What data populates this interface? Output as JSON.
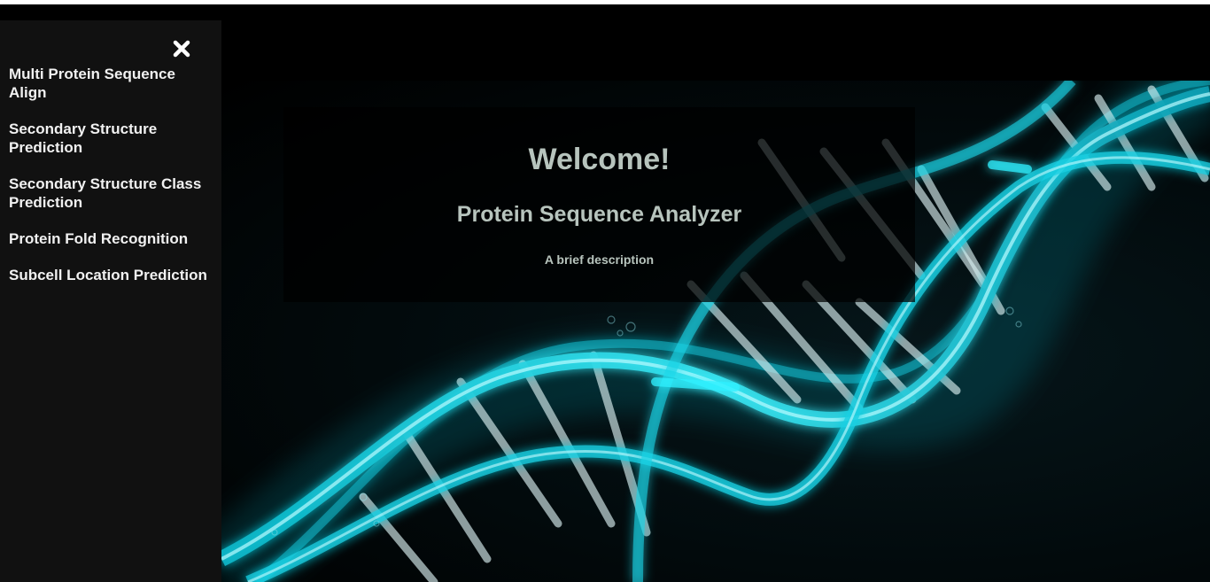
{
  "sidebar": {
    "close_icon": "close-icon",
    "items": [
      {
        "label": "Multi Protein Sequence Align"
      },
      {
        "label": "Secondary Structure Prediction"
      },
      {
        "label": "Secondary Structure Class Prediction"
      },
      {
        "label": "Protein Fold Recognition"
      },
      {
        "label": "Subcell Location Prediction"
      }
    ]
  },
  "hero": {
    "background_image": "dna-helix-image",
    "title": "Welcome!",
    "subtitle": "Protein Sequence Analyzer",
    "description": "A brief description"
  },
  "colors": {
    "sidebar_bg": "#111111",
    "page_bg": "#000000",
    "nav_text": "#f1f1f1",
    "hero_text": "#b7c4bd",
    "helix_accent": "#1fd6e6"
  }
}
